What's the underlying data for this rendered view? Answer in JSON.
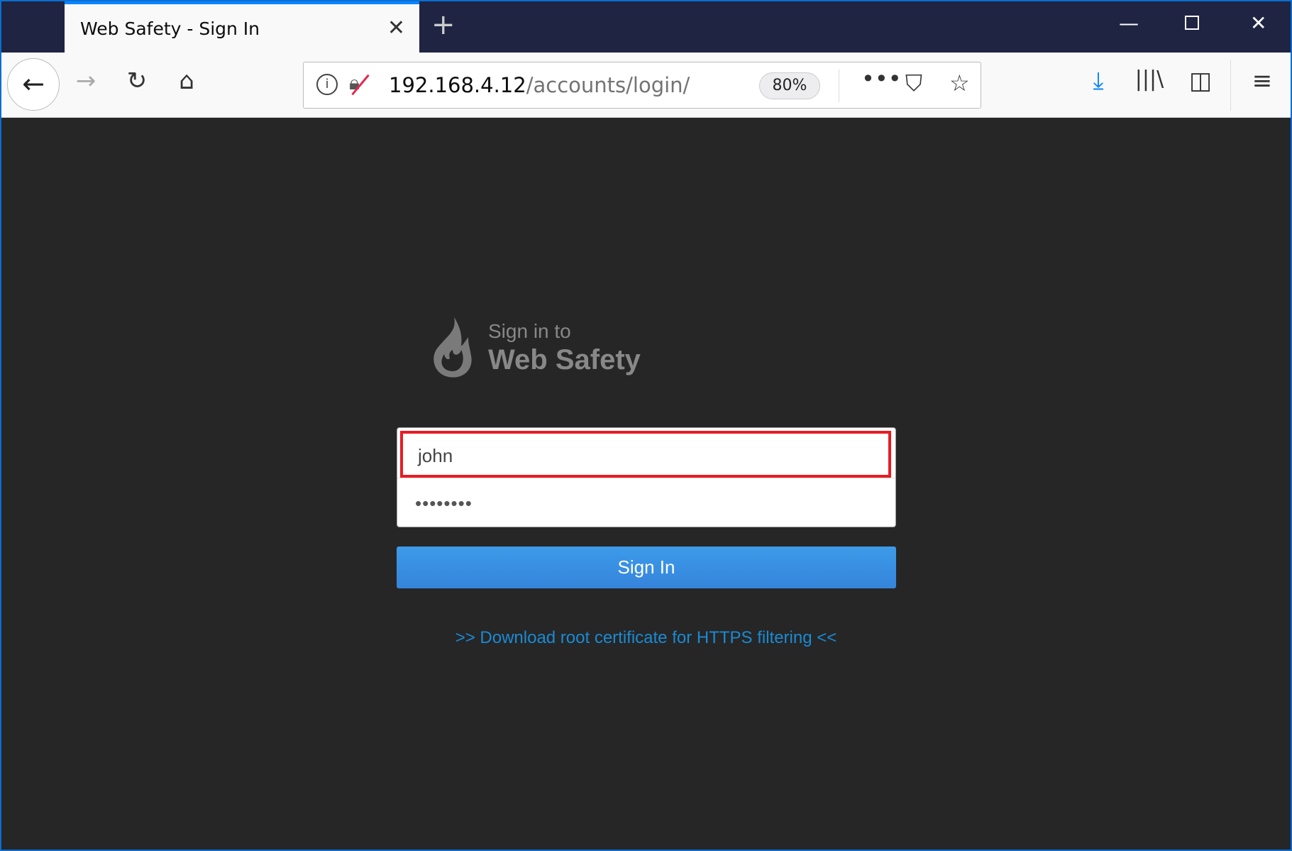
{
  "browser": {
    "tab_title": "Web Safety - Sign In",
    "url_host": "192.168.4.12",
    "url_path": "/accounts/login/",
    "zoom": "80%",
    "accent": "#0a84ff"
  },
  "login": {
    "heading_small": "Sign in to",
    "heading_brand": "Web Safety",
    "username_value": "john",
    "password_value": "••••••••",
    "sign_in_label": "Sign In",
    "cert_link": ">> Download root certificate for HTTPS filtering <<",
    "highlight_color": "#e81c24",
    "button_color": "#3a90e2"
  }
}
